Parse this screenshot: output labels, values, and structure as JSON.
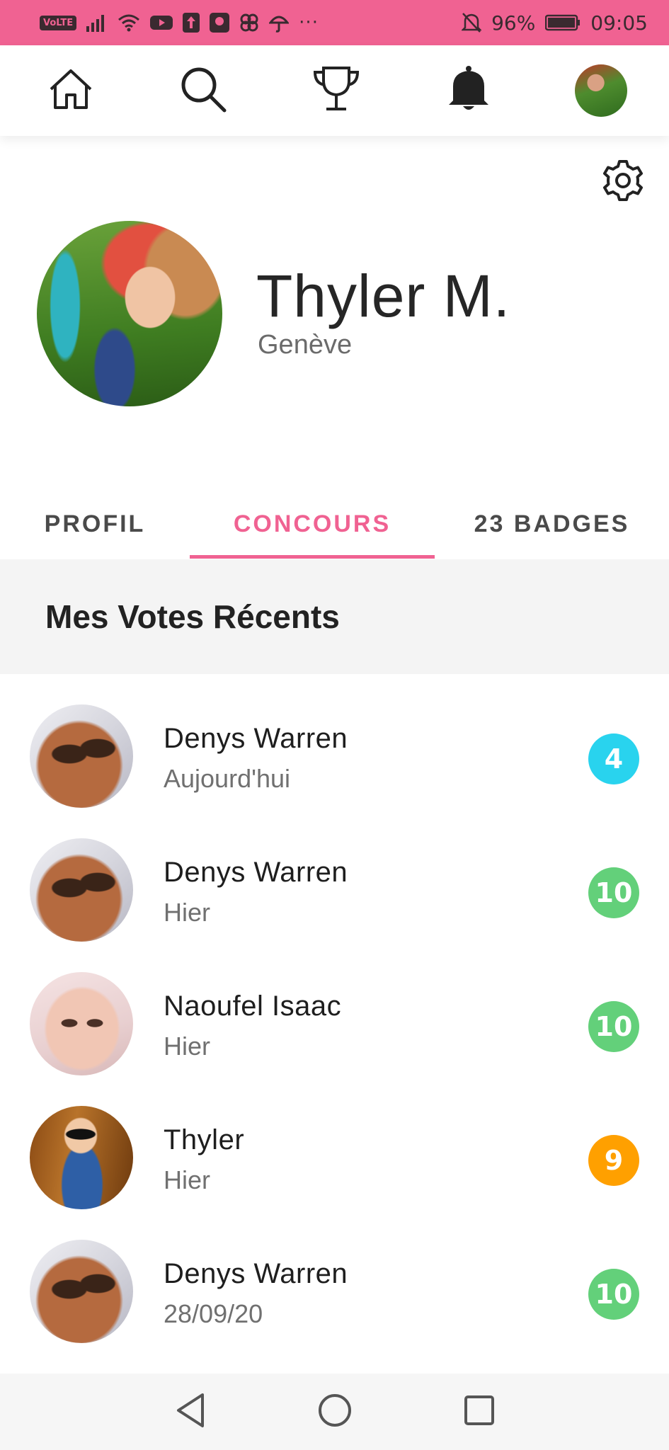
{
  "status_bar": {
    "volte": "VoLTE",
    "battery": "96%",
    "time": "09:05",
    "more": "···",
    "color": "#f06292"
  },
  "nav": {
    "items": [
      {
        "name": "home",
        "icon": "home-icon"
      },
      {
        "name": "search",
        "icon": "search-icon"
      },
      {
        "name": "contests",
        "icon": "trophy-icon"
      },
      {
        "name": "notifications",
        "icon": "bell-icon"
      },
      {
        "name": "profile",
        "icon": "avatar"
      }
    ]
  },
  "profile": {
    "name": "Thyler M.",
    "city": "Genève"
  },
  "tabs": [
    {
      "label": "PROFIL",
      "active": false
    },
    {
      "label": "CONCOURS",
      "active": true
    },
    {
      "label": "23 BADGES",
      "active": false
    }
  ],
  "section": {
    "title": "Mes Votes Récents"
  },
  "votes": [
    {
      "name": "Denys Warren",
      "date": "Aujourd'hui",
      "score": "4",
      "color": "#29d3ee"
    },
    {
      "name": "Denys Warren",
      "date": "Hier",
      "score": "10",
      "color": "#63d07a"
    },
    {
      "name": "Naoufel Isaac",
      "date": "Hier",
      "score": "10",
      "color": "#63d07a"
    },
    {
      "name": "Thyler",
      "date": "Hier",
      "score": "9",
      "color": "#ffa000"
    },
    {
      "name": "Denys Warren",
      "date": "28/09/20",
      "score": "10",
      "color": "#63d07a"
    }
  ],
  "colors": {
    "accent": "#f06292",
    "tab_inactive": "#4a4a4a",
    "section_bg": "#f4f4f4"
  }
}
